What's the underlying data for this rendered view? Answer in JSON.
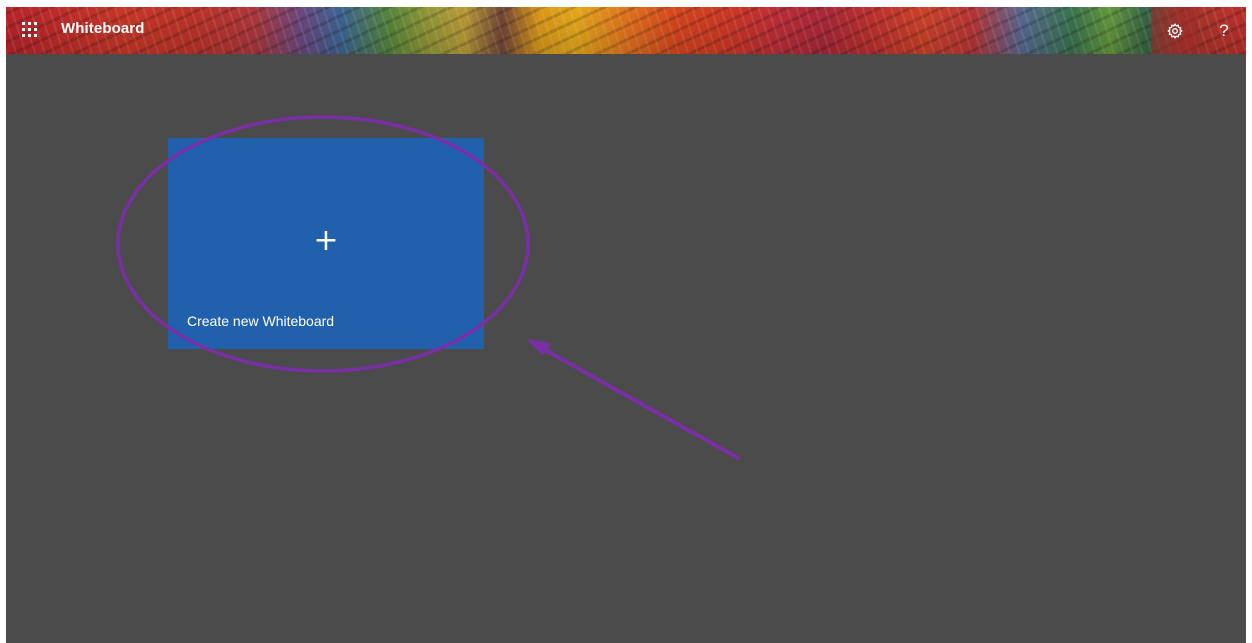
{
  "app": {
    "title": "Whiteboard"
  },
  "header": {
    "app_launcher_icon": "waffle-grid-icon",
    "settings_icon": "gear-icon",
    "help_label": "?"
  },
  "main": {
    "new_board": {
      "icon": "plus-icon",
      "plus_glyph": "+",
      "label": "Create new Whiteboard"
    }
  },
  "colors": {
    "background": "#4b4b4b",
    "tile": "#2060ad",
    "annotation": "#7b2fa6"
  }
}
